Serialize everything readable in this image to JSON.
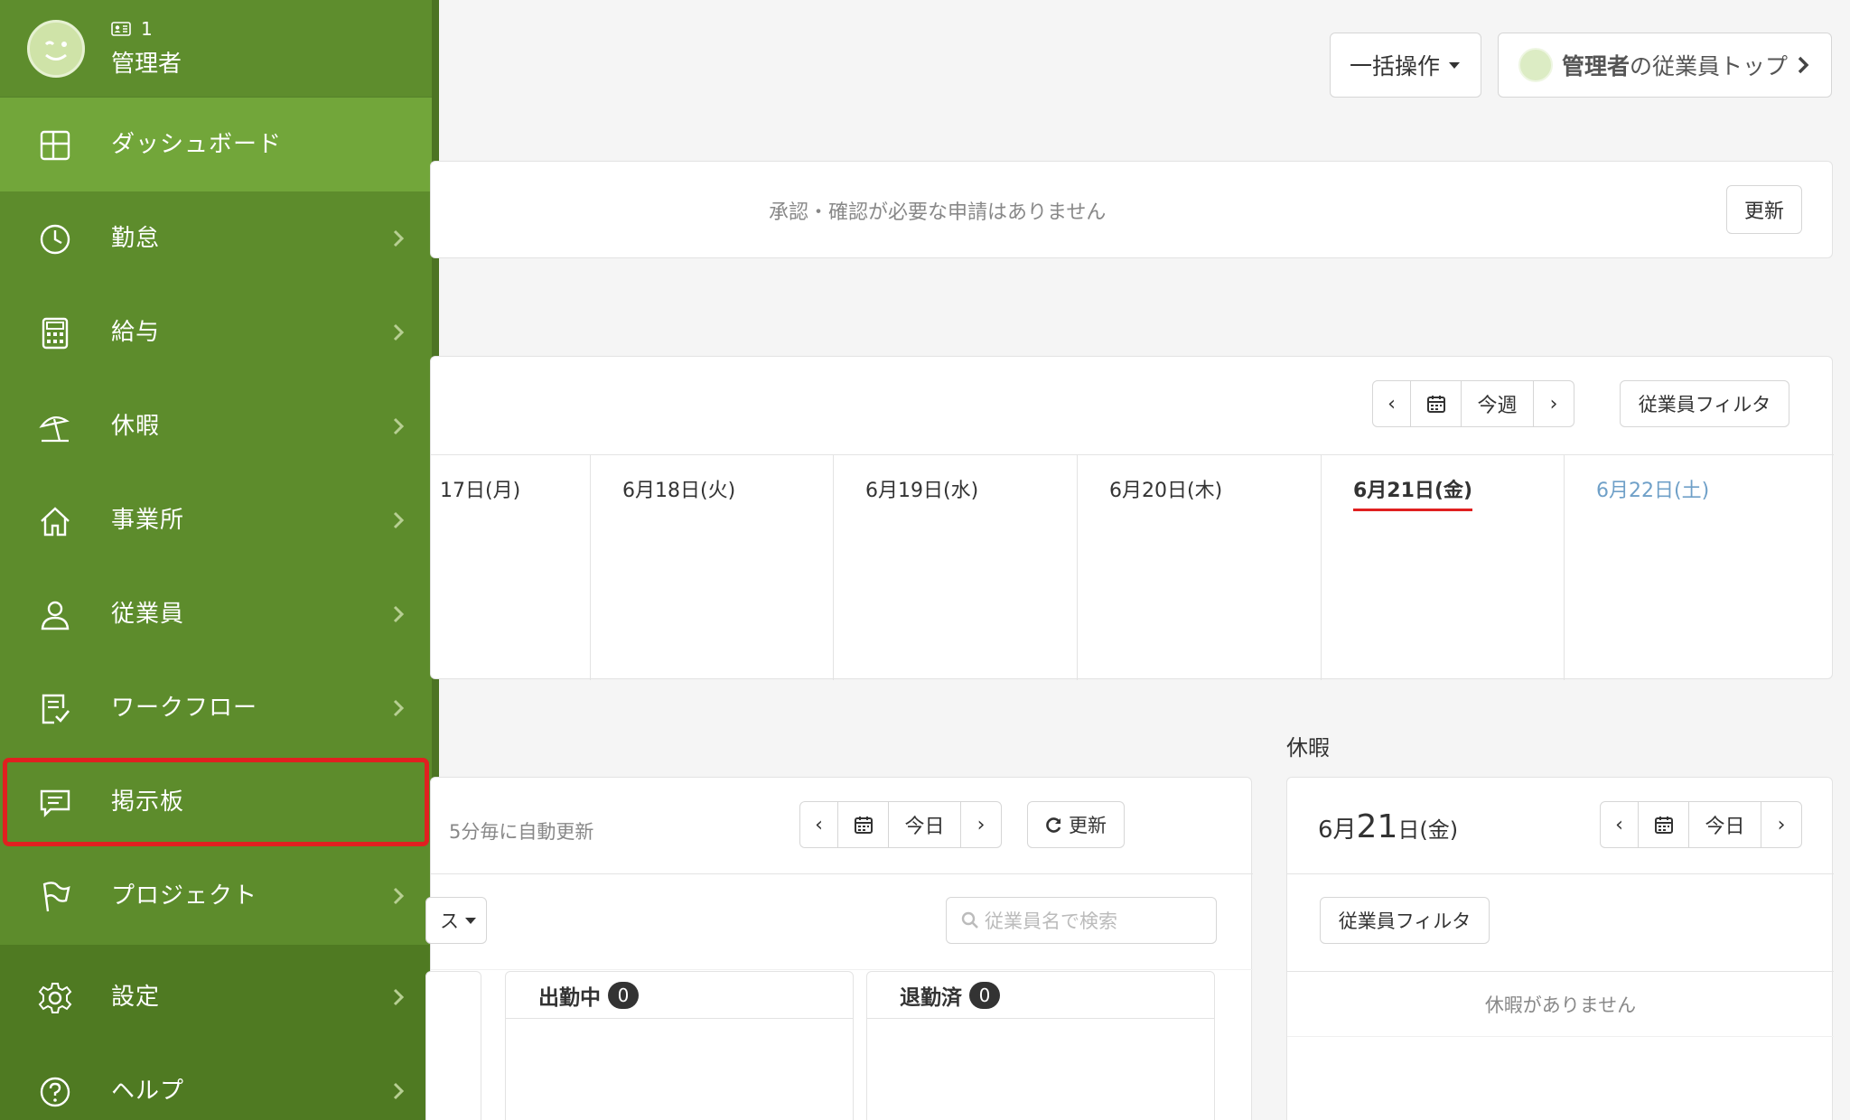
{
  "sidebar": {
    "profile": {
      "id": "1",
      "name": "管理者"
    },
    "items": [
      {
        "label": "ダッシュボード",
        "icon": "dashboard-icon"
      },
      {
        "label": "勤怠",
        "icon": "clock-icon"
      },
      {
        "label": "給与",
        "icon": "calculator-icon"
      },
      {
        "label": "休暇",
        "icon": "beach-umbrella-icon"
      },
      {
        "label": "事業所",
        "icon": "home-icon"
      },
      {
        "label": "従業員",
        "icon": "person-icon"
      },
      {
        "label": "ワークフロー",
        "icon": "checklist-icon"
      },
      {
        "label": "掲示板",
        "icon": "message-icon"
      },
      {
        "label": "プロジェクト",
        "icon": "flag-icon"
      },
      {
        "label": "設定",
        "icon": "gear-icon"
      },
      {
        "label": "ヘルプ",
        "icon": "help-icon"
      }
    ]
  },
  "header": {
    "bulk_label": "一括操作",
    "admin_top_bold": "管理者",
    "admin_top_rest": "の従業員トップ"
  },
  "approvals": {
    "message": "承認・確認が必要な申請はありません",
    "refresh_label": "更新"
  },
  "week": {
    "this_week_label": "今週",
    "filter_label": "従業員フィルタ",
    "days": [
      "17日(月)",
      "6月18日(火)",
      "6月19日(水)",
      "6月20日(木)",
      "6月21日(金)",
      "6月22日(土)"
    ]
  },
  "attendance": {
    "auto_refresh": "5分毎に自動更新",
    "today_label": "今日",
    "refresh_label": "更新",
    "status_dropdown_tail": "ス",
    "search_placeholder": "従業員名で検索",
    "columns": [
      {
        "label": "出勤中",
        "count": "0"
      },
      {
        "label": "退勤済",
        "count": "0"
      }
    ]
  },
  "leave": {
    "heading": "休暇",
    "date_month": "6月",
    "date_day": "21",
    "date_suffix": "日(金)",
    "today_label": "今日",
    "filter_label": "従業員フィルタ",
    "empty": "休暇がありません"
  },
  "colors": {
    "sidebar": "#5d8c2c",
    "sidebar_active": "#72a63a",
    "highlight": "#e02020",
    "today_underline": "#e02020",
    "saturday": "#6fa0c8"
  }
}
